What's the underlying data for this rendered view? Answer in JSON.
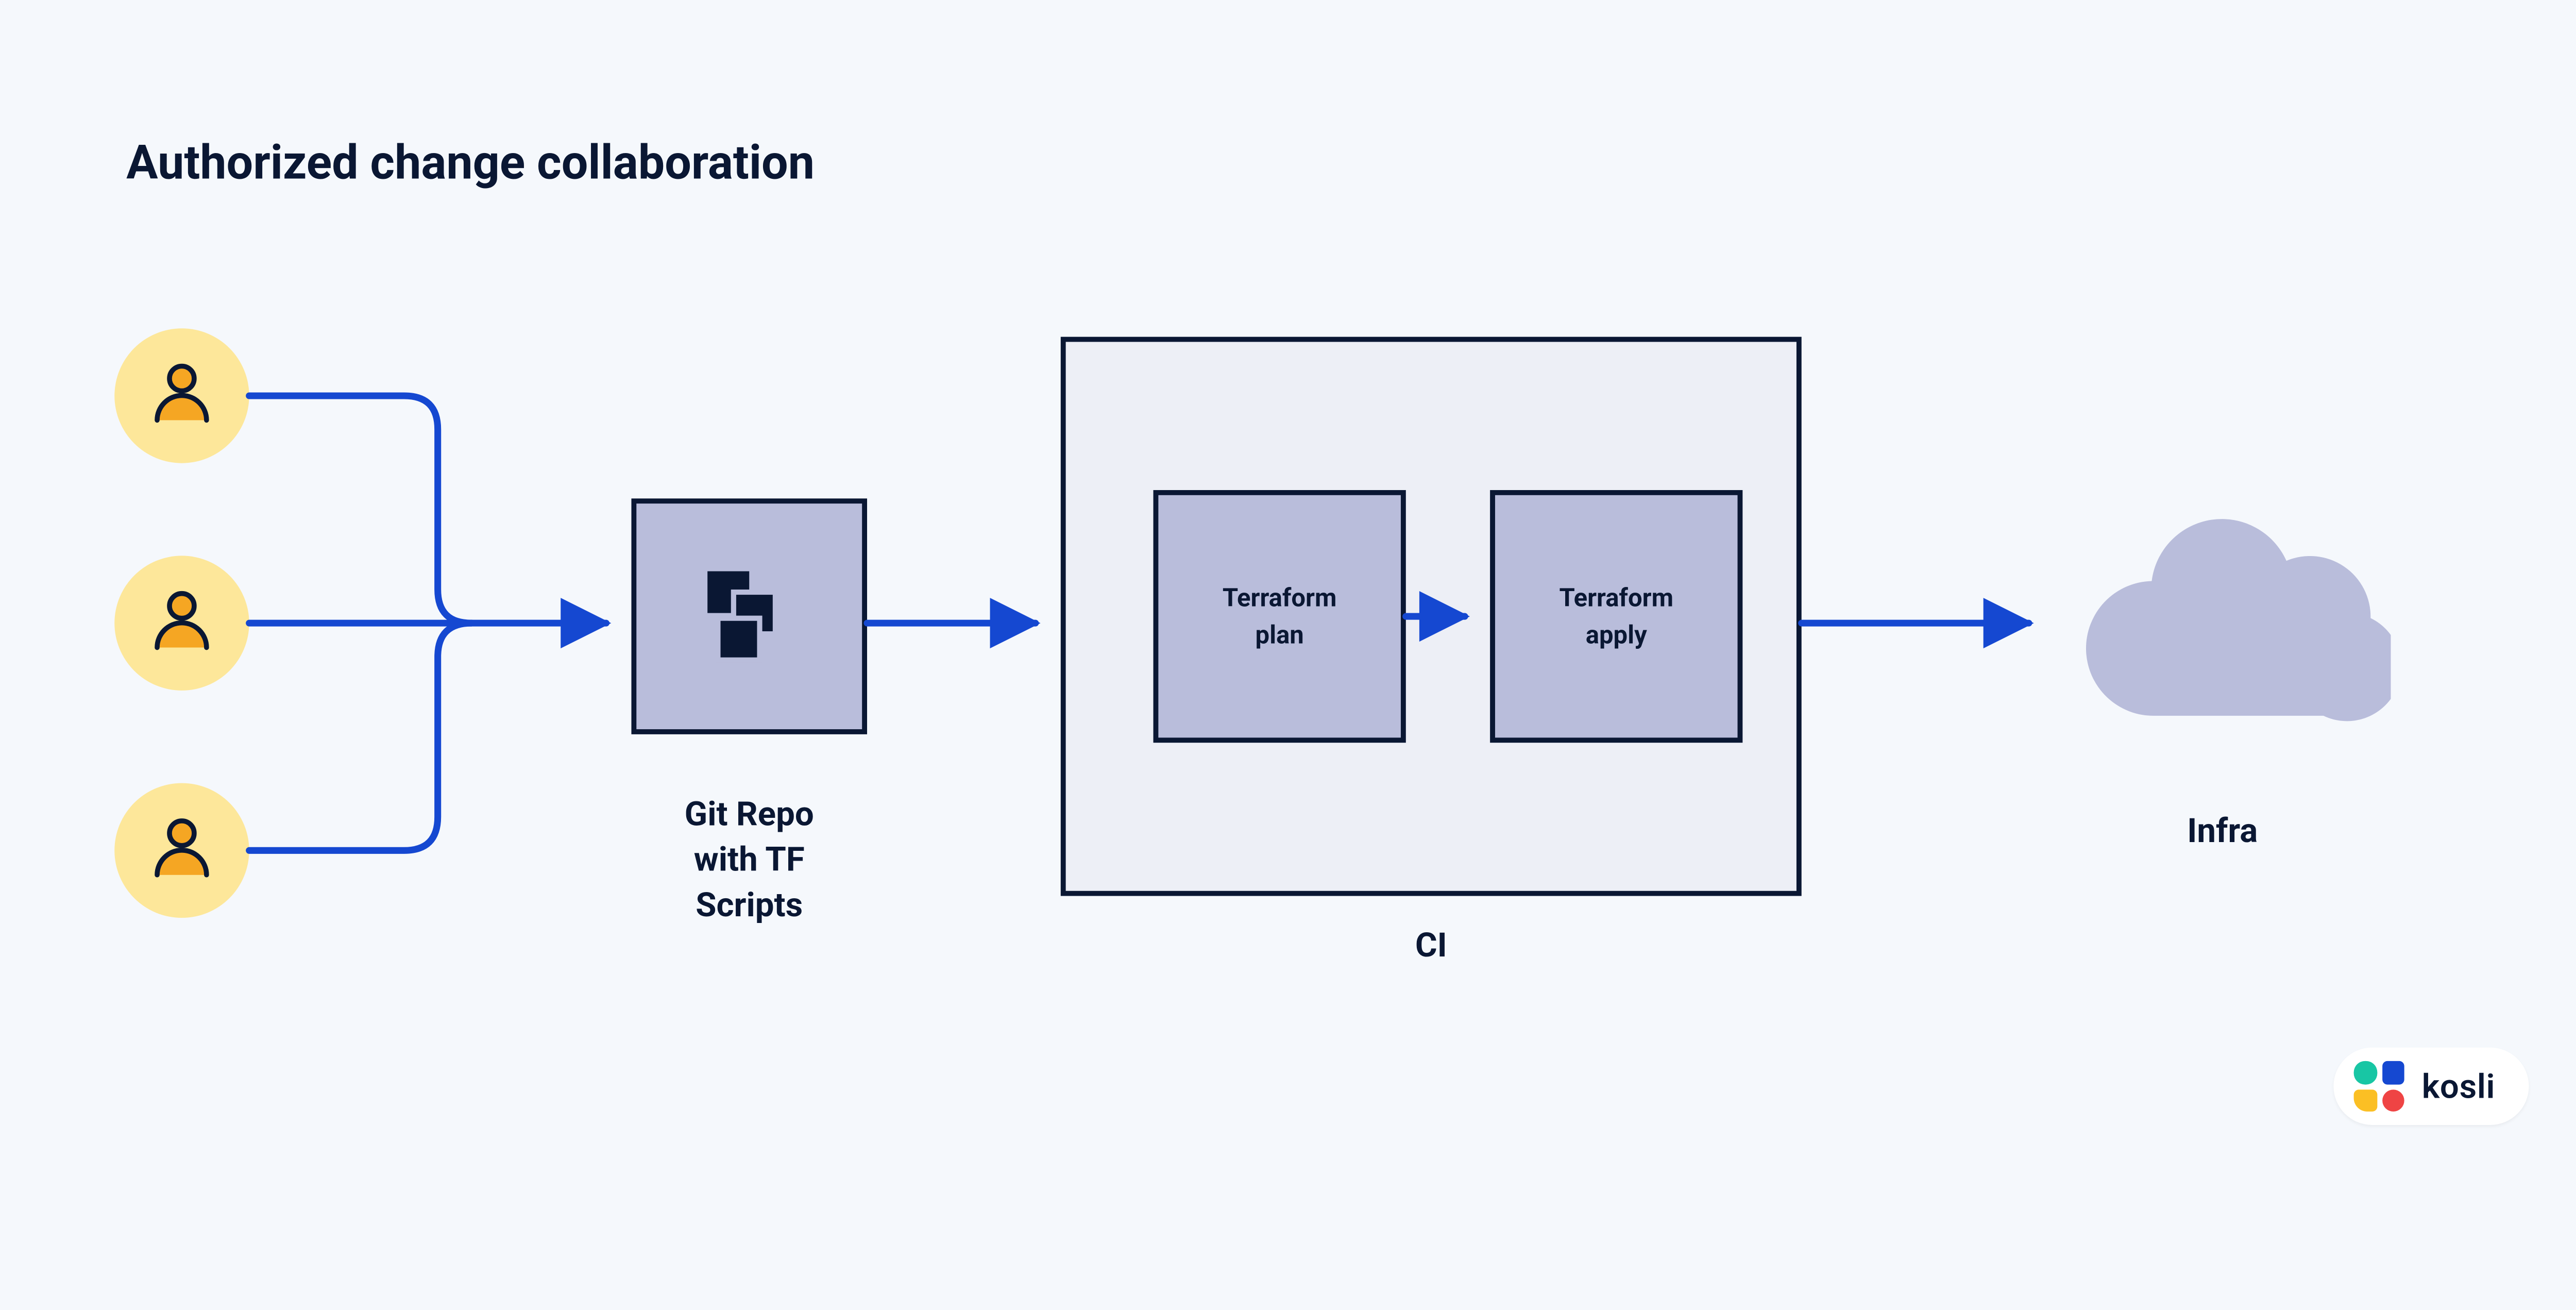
{
  "title": "Authorized change collaboration",
  "nodes": {
    "users": {
      "icon": "user-icon",
      "count": 3
    },
    "repo": {
      "label": "Git Repo\nwith TF\nScripts",
      "icon": "stacked-squares-icon"
    },
    "ci": {
      "label": "CI",
      "steps": {
        "plan": {
          "line1": "Terraform",
          "line2": "plan"
        },
        "apply": {
          "line1": "Terraform",
          "line2": "apply"
        }
      }
    },
    "infra": {
      "label": "Infra",
      "icon": "cloud-icon"
    }
  },
  "flow": [
    {
      "from": "users",
      "to": "repo"
    },
    {
      "from": "repo",
      "to": "ci"
    },
    {
      "from": "ci.plan",
      "to": "ci.apply"
    },
    {
      "from": "ci",
      "to": "infra"
    }
  ],
  "colors": {
    "background": "#f5f8fc",
    "text": "#0a1733",
    "arrow": "#1548d1",
    "box_fill": "#b9bddb",
    "ci_fill": "#edeff6",
    "user_fill": "#fde79a",
    "user_fg": "#f5a623",
    "cloud_fill": "#b9bddb"
  },
  "brand": {
    "name": "kosli"
  }
}
